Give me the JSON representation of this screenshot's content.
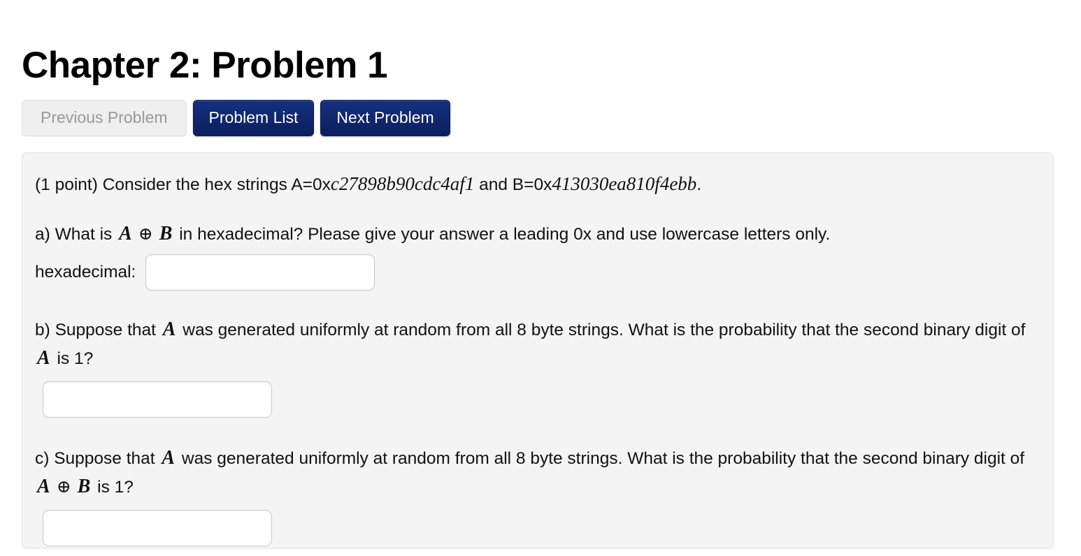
{
  "header": {
    "title": "Chapter 2: Problem 1"
  },
  "nav": {
    "previous_label": "Previous Problem",
    "list_label": "Problem List",
    "next_label": "Next Problem",
    "previous_disabled": true,
    "primary_color": "#112a74",
    "disabled_color": "#efefef"
  },
  "problem": {
    "points_intro": "(1 point) Consider the hex strings A=0x",
    "hex_a": "c27898b90cdc4af1",
    "mid_text": " and B=0x",
    "hex_b": "413030ea810f4ebb",
    "end_punct": ".",
    "parts": {
      "a": {
        "prefix": "a) What is ",
        "var1": "A",
        "operator": "⊕",
        "var2": "B",
        "suffix": " in hexadecimal? Please give your answer a leading 0x and use lowercase letters only.",
        "answer_label": "hexadecimal:",
        "answer_value": "",
        "answer_placeholder": ""
      },
      "b": {
        "prefix": "b) Suppose that ",
        "var1": "A",
        "mid": " was generated uniformly at random from all 8 byte strings. What is the probability that the second binary digit of ",
        "var2": "A",
        "suffix": " is 1?",
        "answer_value": "",
        "answer_placeholder": ""
      },
      "c": {
        "prefix": "c) Suppose that ",
        "var1": "A",
        "mid": " was generated uniformly at random from all 8 byte strings. What is the probability that the second binary digit of ",
        "var2": "A",
        "operator": "⊕",
        "var3": "B",
        "suffix": " is 1?",
        "answer_value": "",
        "answer_placeholder": ""
      }
    }
  }
}
